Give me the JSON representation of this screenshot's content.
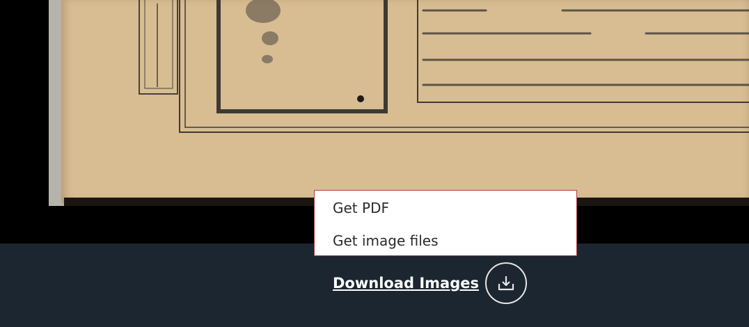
{
  "viewer": {
    "image_alt": "Tibetan manuscript page scan"
  },
  "menu": {
    "items": [
      {
        "label": "Get PDF"
      },
      {
        "label": "Get image files"
      }
    ]
  },
  "footer": {
    "download_label": "Download Images",
    "download_icon": "download-tray-icon"
  },
  "colors": {
    "menu_border": "#b23a44",
    "footer_bg": "#1c2630",
    "paper": "#d8bd93"
  }
}
